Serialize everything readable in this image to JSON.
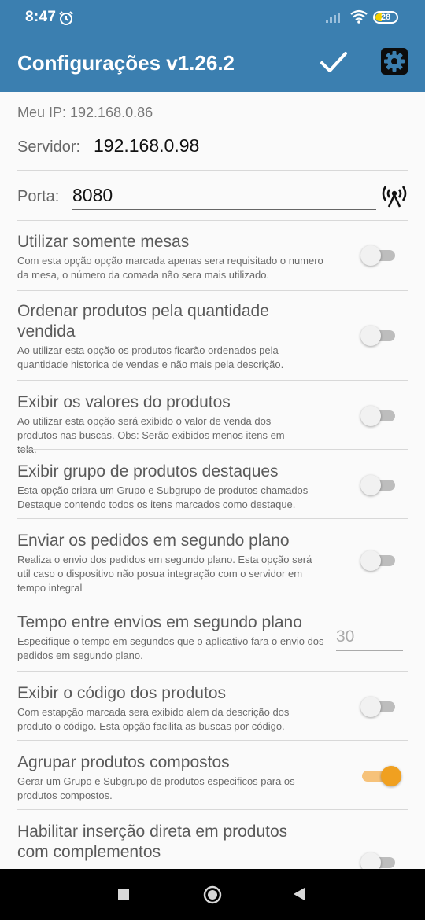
{
  "statusbar": {
    "time": "8:47",
    "battery": "28"
  },
  "appbar": {
    "title": "Configurações v1.26.2"
  },
  "config": {
    "my_ip": "Meu IP: 192.168.0.86",
    "server_label": "Servidor:",
    "server_value": "192.168.0.98",
    "port_label": "Porta:",
    "port_value": "8080"
  },
  "settings": [
    {
      "title": "Utilizar somente mesas",
      "description": "Com esta opção opção marcada apenas sera requisitado o numero da mesa, o número da comada não sera mais utilizado.",
      "enabled": false
    },
    {
      "title": "Ordenar produtos pela quantidade vendida",
      "description": "Ao utilizar esta opção os produtos ficarão ordenados pela quantidade historica de vendas e não mais pela descrição.",
      "enabled": false
    },
    {
      "title": "Exibir os valores do produtos",
      "description": "Ao utilizar esta opção será exibido o valor de venda dos produtos nas buscas. Obs: Serão exibidos menos itens em tela.",
      "enabled": false
    },
    {
      "title": "Exibir grupo de produtos destaques",
      "description": "Esta opção criara um Grupo e Subgrupo de produtos chamados Destaque contendo todos os itens marcados como destaque.",
      "enabled": false
    },
    {
      "title": "Enviar os pedidos em segundo plano",
      "description": "Realiza o envio dos pedidos em segundo plano. Esta opção será util caso o dispositivo não posua integração com o servidor em tempo integral",
      "enabled": false
    },
    {
      "title": "Tempo entre envios em segundo plano",
      "description": "Especifique o tempo em segundos que o aplicativo fara o envio dos pedidos em segundo plano.",
      "value": "30"
    },
    {
      "title": "Exibir o código dos produtos",
      "description": "Com estapção marcada sera exibido alem da descrição dos produto o código. Esta opção facilita as buscas por código.",
      "enabled": false
    },
    {
      "title": "Agrupar produtos compostos",
      "description": "Gerar um Grupo e Subgrupo de produtos especificos para os produtos compostos.",
      "enabled": true
    },
    {
      "title": "Habilitar inserção direta em produtos com complementos",
      "description": "",
      "enabled": false
    }
  ],
  "colors": {
    "primary": "#3b7fb0",
    "accent": "#f0a020"
  }
}
